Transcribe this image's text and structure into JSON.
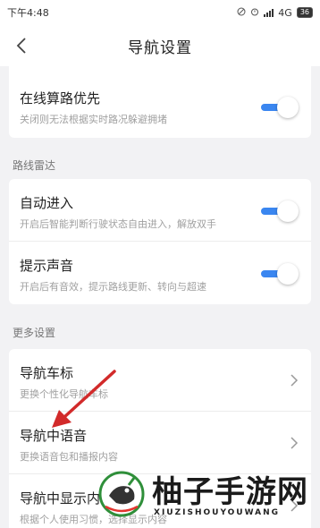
{
  "status_bar": {
    "time": "下午4:48",
    "network": "4G",
    "battery": "36"
  },
  "header": {
    "title": "导航设置"
  },
  "sections": {
    "first": {
      "item": {
        "title": "在线算路优先",
        "subtitle": "关闭则无法根据实时路况躲避拥堵",
        "toggle": "on"
      }
    },
    "route_radar": {
      "label": "路线雷达",
      "items": [
        {
          "title": "自动进入",
          "subtitle": "开启后智能判断行驶状态自由进入，解放双手",
          "toggle": "on"
        },
        {
          "title": "提示声音",
          "subtitle": "开启后有音效，提示路线更新、转向与超速",
          "toggle": "on"
        }
      ]
    },
    "more": {
      "label": "更多设置",
      "items": [
        {
          "title": "导航车标",
          "subtitle": "更换个性化导航车标"
        },
        {
          "title": "导航中语音",
          "subtitle": "更换语音包和播报内容"
        },
        {
          "title": "导航中显示内",
          "subtitle": "根据个人使用习惯，选择显示内容"
        }
      ]
    }
  },
  "watermark": {
    "text": "柚子手游网",
    "sub": "XIUZISHOUYOUWANG"
  },
  "colors": {
    "accent": "#3a86f0",
    "annotation_arrow": "#d22a2a"
  }
}
